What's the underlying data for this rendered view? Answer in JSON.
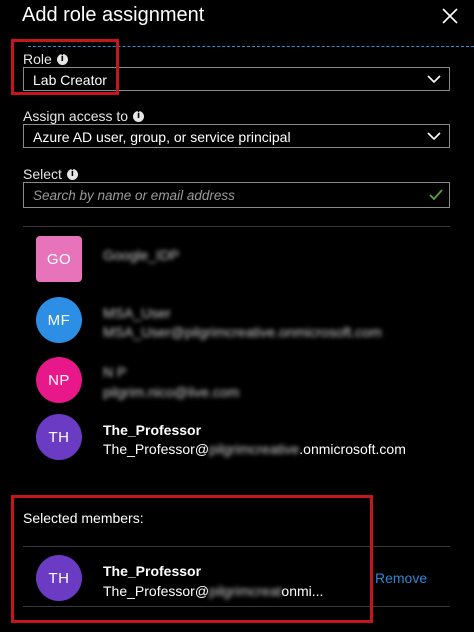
{
  "header": {
    "title": "Add role assignment"
  },
  "role": {
    "label": "Role",
    "value": "Lab Creator"
  },
  "assign_access": {
    "label": "Assign access to",
    "value": "Azure AD user, group, or service principal"
  },
  "select": {
    "label": "Select",
    "placeholder": "Search by name or email address"
  },
  "results": [
    {
      "initials": "GO",
      "color": "#e774bb",
      "name": "Google_IDP",
      "email": ""
    },
    {
      "initials": "MF",
      "color": "#2d8ee6",
      "name": "MSA_User",
      "email": "MSA_User@pilgrimcreative.onmicrosoft.com"
    },
    {
      "initials": "NP",
      "color": "#e8178a",
      "name": "N P",
      "email": "pilgrim.nico@live.com"
    },
    {
      "initials": "TH",
      "color": "#6b3bc4",
      "name": "The_Professor",
      "email_prefix": "The_Professor@",
      "email_hidden": "pilgrimcreative",
      "email_suffix": ".onmicrosoft.com"
    }
  ],
  "selected": {
    "label": "Selected members:",
    "member": {
      "initials": "TH",
      "color": "#6b3bc4",
      "name": "The_Professor",
      "email_prefix": "The_Professor@",
      "email_hidden": "pilgrimcreat",
      "email_suffix": "onmi..."
    },
    "remove_label": "Remove"
  },
  "colors": {
    "highlight": "#c5161d",
    "link": "#2b88d8",
    "check": "#57a639"
  }
}
